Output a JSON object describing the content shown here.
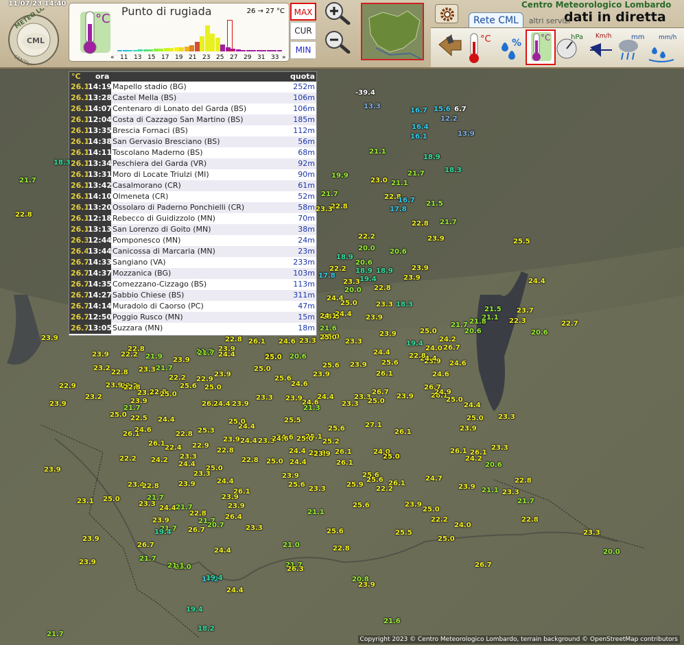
{
  "header": {
    "datetime": "11/07/23 14:40",
    "site_title": "Centro Meteorologico Lombardo",
    "site_subtitle": "dati in diretta",
    "logo_text": "METEO LOMBARDO",
    "logo_caption": "CENTRO",
    "logo_badge": "CML"
  },
  "panel": {
    "title": "Punto di rugiada",
    "unit": "°C",
    "range_label": "26 → 27 °C",
    "histogram": {
      "axis_labels": [
        "11",
        "13",
        "15",
        "17",
        "19",
        "21",
        "23",
        "25",
        "27",
        "29",
        "31",
        "33"
      ],
      "prev_arrow": "«",
      "next_arrow": "»",
      "selected_range": [
        26,
        27
      ]
    }
  },
  "mode_buttons": {
    "max": "MAX",
    "cur": "CUR",
    "min": "MIN",
    "active": "MAX"
  },
  "tabs": {
    "cml": "Rete CML",
    "altri": "altri servizi"
  },
  "params": {
    "hpa": "hPa",
    "kmh": "Km/h",
    "mm": "mm",
    "mmh": "mm/h",
    "temp_unit": "°C",
    "dew_unit": "°C",
    "humidity": "%"
  },
  "table": {
    "headers": {
      "temp": "°C",
      "time": "ora",
      "alt": "quota"
    },
    "rows": [
      {
        "t": "26.1",
        "h": "14:19",
        "n": "Mapello stadio (BG)",
        "q": "252m"
      },
      {
        "t": "26.1",
        "h": "13:28",
        "n": "Castel Mella (BS)",
        "q": "106m"
      },
      {
        "t": "26.1",
        "h": "14:07",
        "n": "Centenaro di Lonato del Garda (BS)",
        "q": "106m"
      },
      {
        "t": "26.1",
        "h": "12:04",
        "n": "Costa di Cazzago San Martino (BS)",
        "q": "185m"
      },
      {
        "t": "26.1",
        "h": "13:35",
        "n": "Brescia Fornaci (BS)",
        "q": "112m"
      },
      {
        "t": "26.1",
        "h": "14:38",
        "n": "San Gervasio Bresciano (BS)",
        "q": "56m"
      },
      {
        "t": "26.1",
        "h": "14:11",
        "n": "Toscolano Maderno (BS)",
        "q": "68m"
      },
      {
        "t": "26.1",
        "h": "13:34",
        "n": "Peschiera del Garda (VR)",
        "q": "92m"
      },
      {
        "t": "26.1",
        "h": "13:31",
        "n": "Moro di Locate Triulzi (MI)",
        "q": "90m"
      },
      {
        "t": "26.1",
        "h": "13:42",
        "n": "Casalmorano (CR)",
        "q": "61m"
      },
      {
        "t": "26.1",
        "h": "14:10",
        "n": "Olmeneta (CR)",
        "q": "52m"
      },
      {
        "t": "26.1",
        "h": "13:20",
        "n": "Ossolaro di Paderno Ponchielli (CR)",
        "q": "58m"
      },
      {
        "t": "26.1",
        "h": "12:18",
        "n": "Rebecco di Guidizzolo (MN)",
        "q": "70m"
      },
      {
        "t": "26.1",
        "h": "13:13",
        "n": "San Lorenzo di Goito (MN)",
        "q": "38m"
      },
      {
        "t": "26.3",
        "h": "12:44",
        "n": "Pomponesco (MN)",
        "q": "24m"
      },
      {
        "t": "26.4",
        "h": "13:44",
        "n": "Canicossa di Marcaria (MN)",
        "q": "23m"
      },
      {
        "t": "26.7",
        "h": "14:33",
        "n": "Sangiano (VA)",
        "q": "233m"
      },
      {
        "t": "26.7",
        "h": "14:37",
        "n": "Mozzanica (BG)",
        "q": "103m"
      },
      {
        "t": "26.7",
        "h": "14:35",
        "n": "Comezzano-Cizzago (BS)",
        "q": "113m"
      },
      {
        "t": "26.7",
        "h": "14:27",
        "n": "Sabbio Chiese (BS)",
        "q": "311m"
      },
      {
        "t": "26.7",
        "h": "14:14",
        "n": "Muradolo di Caorso (PC)",
        "q": "47m"
      },
      {
        "t": "26.7",
        "h": "12:50",
        "n": "Poggio Rusco (MN)",
        "q": "15m"
      },
      {
        "t": "26.7",
        "h": "13:05",
        "n": "Suzzara (MN)",
        "q": "18m"
      }
    ]
  },
  "map": {
    "copyright": "Copyright 2023 © Centro Meteorologico Lombardo, terrain background © OpenStreetMap contributors",
    "stations": [
      {
        "v": "-39.4",
        "c": "w"
      },
      {
        "v": "13.3",
        "c": "b"
      },
      {
        "v": "16.7",
        "c": "c"
      },
      {
        "v": "15.6",
        "c": "c"
      },
      {
        "v": "6.7",
        "c": "w"
      },
      {
        "v": "12.2",
        "c": "b"
      },
      {
        "v": "16.4",
        "c": "c"
      },
      {
        "v": "16.1",
        "c": "c"
      },
      {
        "v": "13.9",
        "c": "b"
      },
      {
        "v": "18.3",
        "c": "t"
      },
      {
        "v": "21.7",
        "c": "g"
      },
      {
        "v": "22.8",
        "c": "y"
      },
      {
        "v": "21.1",
        "c": "g"
      },
      {
        "v": "18.9",
        "c": "t"
      },
      {
        "v": "18.3",
        "c": "t"
      },
      {
        "v": "19.9",
        "c": "g"
      },
      {
        "v": "23.0",
        "c": "y"
      },
      {
        "v": "21.1",
        "c": "g"
      },
      {
        "v": "21.7",
        "c": "g"
      },
      {
        "v": "21.7",
        "c": "g"
      },
      {
        "v": "22.8",
        "c": "y"
      },
      {
        "v": "22.8",
        "c": "y"
      },
      {
        "v": "16.7",
        "c": "c"
      },
      {
        "v": "17.8",
        "c": "c"
      },
      {
        "v": "21.5",
        "c": "g"
      },
      {
        "v": "23.3",
        "c": "y"
      },
      {
        "v": "22.8",
        "c": "y"
      },
      {
        "v": "21.7",
        "c": "g"
      },
      {
        "v": "22.2",
        "c": "y"
      },
      {
        "v": "23.9",
        "c": "y"
      },
      {
        "v": "25.5",
        "c": "y"
      },
      {
        "v": "20.0",
        "c": "g"
      },
      {
        "v": "20.6",
        "c": "g"
      },
      {
        "v": "18.9",
        "c": "t"
      },
      {
        "v": "20.6",
        "c": "g"
      },
      {
        "v": "22.2",
        "c": "y"
      },
      {
        "v": "17.8",
        "c": "c"
      },
      {
        "v": "18.9",
        "c": "t"
      },
      {
        "v": "19.4",
        "c": "t"
      },
      {
        "v": "18.9",
        "c": "t"
      },
      {
        "v": "23.9",
        "c": "y"
      },
      {
        "v": "23.9",
        "c": "y"
      },
      {
        "v": "23.3",
        "c": "y"
      },
      {
        "v": "22.8",
        "c": "y"
      },
      {
        "v": "24.4",
        "c": "y"
      },
      {
        "v": "20.0",
        "c": "g"
      },
      {
        "v": "24.4",
        "c": "y"
      },
      {
        "v": "25.0",
        "c": "y"
      },
      {
        "v": "23.3",
        "c": "y"
      },
      {
        "v": "18.3",
        "c": "t"
      },
      {
        "v": "21.5",
        "c": "g"
      },
      {
        "v": "23.7",
        "c": "y"
      },
      {
        "v": "25.0",
        "c": "y"
      },
      {
        "v": "24.1",
        "c": "y"
      },
      {
        "v": "24.4",
        "c": "y"
      },
      {
        "v": "23.9",
        "c": "y"
      },
      {
        "v": "21.1",
        "c": "g"
      },
      {
        "v": "22.3",
        "c": "y"
      },
      {
        "v": "22.7",
        "c": "y"
      },
      {
        "v": "21.6",
        "c": "g"
      },
      {
        "v": "21.7",
        "c": "g"
      },
      {
        "v": "20.6",
        "c": "g"
      },
      {
        "v": "21.8",
        "c": "g"
      },
      {
        "v": "20.6",
        "c": "g"
      },
      {
        "v": "25.0",
        "c": "y"
      },
      {
        "v": "23.9",
        "c": "y"
      },
      {
        "v": "25.0",
        "c": "y"
      },
      {
        "v": "24.2",
        "c": "y"
      },
      {
        "v": "19.4",
        "c": "t"
      },
      {
        "v": "24.0",
        "c": "y"
      },
      {
        "v": "26.7",
        "c": "y"
      },
      {
        "v": "24.6",
        "c": "y"
      },
      {
        "v": "23.9",
        "c": "y"
      },
      {
        "v": "21.7",
        "c": "g"
      },
      {
        "v": "23.9",
        "c": "y"
      },
      {
        "v": "25.0",
        "c": "y"
      },
      {
        "v": "26.1",
        "c": "y"
      },
      {
        "v": "22.8",
        "c": "y"
      },
      {
        "v": "24.6",
        "c": "y"
      },
      {
        "v": "23.3",
        "c": "y"
      },
      {
        "v": "25.0",
        "c": "y"
      },
      {
        "v": "23.3",
        "c": "y"
      },
      {
        "v": "23.9",
        "c": "y"
      },
      {
        "v": "22.8",
        "c": "y"
      },
      {
        "v": "22.2",
        "c": "y"
      },
      {
        "v": "21.9",
        "c": "g"
      },
      {
        "v": "23.9",
        "c": "y"
      },
      {
        "v": "21.7",
        "c": "g"
      },
      {
        "v": "24.4",
        "c": "y"
      },
      {
        "v": "25.0",
        "c": "y"
      },
      {
        "v": "20.6",
        "c": "g"
      },
      {
        "v": "25.6",
        "c": "y"
      },
      {
        "v": "23.9",
        "c": "y"
      },
      {
        "v": "24.4",
        "c": "y"
      },
      {
        "v": "25.6",
        "c": "y"
      },
      {
        "v": "24.4",
        "c": "y"
      },
      {
        "v": "24.6",
        "c": "y"
      },
      {
        "v": "26.1",
        "c": "y"
      },
      {
        "v": "23.2",
        "c": "y"
      },
      {
        "v": "22.8",
        "c": "y"
      },
      {
        "v": "23.3",
        "c": "y"
      },
      {
        "v": "21.7",
        "c": "g"
      },
      {
        "v": "22.2",
        "c": "y"
      },
      {
        "v": "22.9",
        "c": "y"
      },
      {
        "v": "23.9",
        "c": "y"
      },
      {
        "v": "25.0",
        "c": "y"
      },
      {
        "v": "25.6",
        "c": "y"
      },
      {
        "v": "24.6",
        "c": "y"
      },
      {
        "v": "23.9",
        "c": "y"
      },
      {
        "v": "24.4",
        "c": "y"
      },
      {
        "v": "24.6",
        "c": "y"
      },
      {
        "v": "23.9",
        "c": "y"
      },
      {
        "v": "22.2",
        "c": "y"
      },
      {
        "v": "22.8",
        "c": "y"
      },
      {
        "v": "23.3",
        "c": "y"
      },
      {
        "v": "22.8",
        "c": "y"
      },
      {
        "v": "25.0",
        "c": "y"
      },
      {
        "v": "25.6",
        "c": "y"
      },
      {
        "v": "25.0",
        "c": "y"
      },
      {
        "v": "26.1",
        "c": "y"
      },
      {
        "v": "24.4",
        "c": "y"
      },
      {
        "v": "23.9",
        "c": "y"
      },
      {
        "v": "24.4",
        "c": "y"
      },
      {
        "v": "23.3",
        "c": "y"
      },
      {
        "v": "21.3",
        "c": "g"
      },
      {
        "v": "23.3",
        "c": "y"
      },
      {
        "v": "23.3",
        "c": "y"
      },
      {
        "v": "25.0",
        "c": "y"
      },
      {
        "v": "26.7",
        "c": "y"
      },
      {
        "v": "23.9",
        "c": "y"
      },
      {
        "v": "26.7",
        "c": "y"
      },
      {
        "v": "26.1",
        "c": "y"
      },
      {
        "v": "25.0",
        "c": "y"
      },
      {
        "v": "24.4",
        "c": "y"
      },
      {
        "v": "25.0",
        "c": "y"
      },
      {
        "v": "23.3",
        "c": "y"
      },
      {
        "v": "23.9",
        "c": "y"
      },
      {
        "v": "21.7",
        "c": "g"
      },
      {
        "v": "22.5",
        "c": "y"
      },
      {
        "v": "24.4",
        "c": "y"
      },
      {
        "v": "25.0",
        "c": "y"
      },
      {
        "v": "25.5",
        "c": "y"
      },
      {
        "v": "25.1",
        "c": "y"
      },
      {
        "v": "25.6",
        "c": "y"
      },
      {
        "v": "27.1",
        "c": "y"
      },
      {
        "v": "26.1",
        "c": "y"
      },
      {
        "v": "24.4",
        "c": "y"
      },
      {
        "v": "24.6",
        "c": "y"
      },
      {
        "v": "23.3",
        "c": "y"
      },
      {
        "v": "22.8",
        "c": "y"
      },
      {
        "v": "26.1",
        "c": "y"
      },
      {
        "v": "25.3",
        "c": "y"
      },
      {
        "v": "23.9",
        "c": "y"
      },
      {
        "v": "24.4",
        "c": "y"
      },
      {
        "v": "24.6",
        "c": "y"
      },
      {
        "v": "25.0",
        "c": "y"
      },
      {
        "v": "25.2",
        "c": "y"
      },
      {
        "v": "24.4",
        "c": "y"
      },
      {
        "v": "26.1",
        "c": "y"
      },
      {
        "v": "24.0",
        "c": "y"
      },
      {
        "v": "26.1",
        "c": "y"
      },
      {
        "v": "24.2",
        "c": "y"
      },
      {
        "v": "23.3",
        "c": "y"
      },
      {
        "v": "23.9",
        "c": "y"
      },
      {
        "v": "22.2",
        "c": "y"
      },
      {
        "v": "24.2",
        "c": "y"
      },
      {
        "v": "24.4",
        "c": "y"
      },
      {
        "v": "22.8",
        "c": "y"
      },
      {
        "v": "25.0",
        "c": "y"
      },
      {
        "v": "24.4",
        "c": "y"
      },
      {
        "v": "23.9",
        "c": "y"
      },
      {
        "v": "26.1",
        "c": "y"
      },
      {
        "v": "25.0",
        "c": "y"
      },
      {
        "v": "26.1",
        "c": "y"
      },
      {
        "v": "25.6",
        "c": "y"
      },
      {
        "v": "25.6",
        "c": "y"
      },
      {
        "v": "26.1",
        "c": "y"
      },
      {
        "v": "24.7",
        "c": "y"
      },
      {
        "v": "23.9",
        "c": "y"
      },
      {
        "v": "22.8",
        "c": "y"
      },
      {
        "v": "23.4",
        "c": "y"
      },
      {
        "v": "22.8",
        "c": "y"
      },
      {
        "v": "24.4",
        "c": "y"
      },
      {
        "v": "26.1",
        "c": "y"
      },
      {
        "v": "23.9",
        "c": "y"
      },
      {
        "v": "25.6",
        "c": "y"
      },
      {
        "v": "23.3",
        "c": "y"
      },
      {
        "v": "25.9",
        "c": "y"
      },
      {
        "v": "22.2",
        "c": "y"
      },
      {
        "v": "23.3",
        "c": "y"
      },
      {
        "v": "21.7",
        "c": "g"
      },
      {
        "v": "23.1",
        "c": "y"
      },
      {
        "v": "25.0",
        "c": "y"
      },
      {
        "v": "23.3",
        "c": "y"
      },
      {
        "v": "24.4",
        "c": "y"
      },
      {
        "v": "22.8",
        "c": "y"
      },
      {
        "v": "23.9",
        "c": "y"
      },
      {
        "v": "23.9",
        "c": "y"
      },
      {
        "v": "25.6",
        "c": "y"
      },
      {
        "v": "23.9",
        "c": "y"
      },
      {
        "v": "25.0",
        "c": "y"
      },
      {
        "v": "24.0",
        "c": "y"
      },
      {
        "v": "21.1",
        "c": "g"
      },
      {
        "v": "21.7",
        "c": "g"
      },
      {
        "v": "21.7",
        "c": "g"
      },
      {
        "v": "23.9",
        "c": "y"
      },
      {
        "v": "26.4",
        "c": "y"
      },
      {
        "v": "23.3",
        "c": "y"
      },
      {
        "v": "22.2",
        "c": "y"
      },
      {
        "v": "22.8",
        "c": "y"
      },
      {
        "v": "25.5",
        "c": "y"
      },
      {
        "v": "26.7",
        "c": "y"
      },
      {
        "v": "25.6",
        "c": "y"
      },
      {
        "v": "25.0",
        "c": "y"
      },
      {
        "v": "21.7",
        "c": "g"
      },
      {
        "v": "19.4",
        "c": "t"
      },
      {
        "v": "21.7",
        "c": "g"
      },
      {
        "v": "20.7",
        "c": "g"
      },
      {
        "v": "23.9",
        "c": "y"
      },
      {
        "v": "26.7",
        "c": "y"
      },
      {
        "v": "23.9",
        "c": "y"
      },
      {
        "v": "24.4",
        "c": "y"
      },
      {
        "v": "21.7",
        "c": "g"
      },
      {
        "v": "21.0",
        "c": "g"
      },
      {
        "v": "21.7",
        "c": "g"
      },
      {
        "v": "23.3",
        "c": "y"
      },
      {
        "v": "21.0",
        "c": "g"
      },
      {
        "v": "21.1",
        "c": "g"
      },
      {
        "v": "26.3",
        "c": "y"
      },
      {
        "v": "26.7",
        "c": "y"
      },
      {
        "v": "20.0",
        "c": "g"
      },
      {
        "v": "17.2",
        "c": "c"
      },
      {
        "v": "19.4",
        "c": "t"
      },
      {
        "v": "24.4",
        "c": "y"
      },
      {
        "v": "20.8",
        "c": "g"
      },
      {
        "v": "19.4",
        "c": "t"
      },
      {
        "v": "18.2",
        "c": "t"
      },
      {
        "v": "21.7",
        "c": "g"
      },
      {
        "v": "23.9",
        "c": "y"
      },
      {
        "v": "22.9",
        "c": "y"
      },
      {
        "v": "23.9",
        "c": "y"
      },
      {
        "v": "25.0",
        "c": "y"
      },
      {
        "v": "24.6",
        "c": "y"
      },
      {
        "v": "23.9",
        "c": "y"
      },
      {
        "v": "23.2",
        "c": "y"
      },
      {
        "v": "22.9",
        "c": "y"
      },
      {
        "v": "22.8",
        "c": "y"
      },
      {
        "v": "23.9",
        "c": "y"
      },
      {
        "v": "26.1",
        "c": "y"
      },
      {
        "v": "22.4",
        "c": "y"
      },
      {
        "v": "23.3",
        "c": "y"
      },
      {
        "v": "25.0",
        "c": "y"
      },
      {
        "v": "23.3",
        "c": "y"
      },
      {
        "v": "23.9",
        "c": "y"
      },
      {
        "v": "21.1",
        "c": "g"
      },
      {
        "v": "22.8",
        "c": "y"
      },
      {
        "v": "23.9",
        "c": "y"
      },
      {
        "v": "21.6",
        "c": "g"
      },
      {
        "v": "22.8",
        "c": "y"
      },
      {
        "v": "24.9",
        "c": "y"
      },
      {
        "v": "23.9",
        "c": "y"
      },
      {
        "v": "20.6",
        "c": "g"
      }
    ]
  },
  "colors": {
    "w": "#ffffff",
    "b": "#7fb2e6",
    "c": "#35d0f0",
    "t": "#34e0a0",
    "g": "#9bf032",
    "y": "#f4f020",
    "accent_red": "#d11111"
  }
}
